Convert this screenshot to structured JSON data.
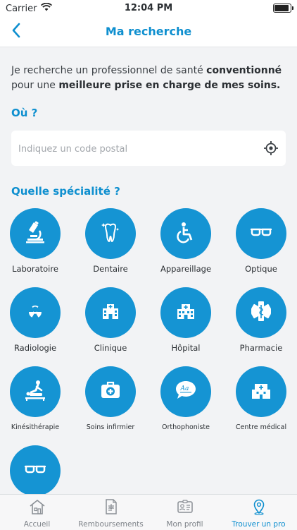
{
  "status_bar": {
    "carrier": "Carrier",
    "time": "12:04 PM"
  },
  "nav": {
    "title": "Ma recherche"
  },
  "intro": {
    "part1": "Je recherche un professionnel de santé ",
    "bold1": "conventionné",
    "part2": " pour une ",
    "bold2": "meilleure prise en charge de mes soins."
  },
  "location": {
    "title": "Où ?",
    "placeholder": "Indiquez un code postal",
    "value": ""
  },
  "specialty": {
    "title": "Quelle spécialité ?",
    "items": [
      {
        "label": "Laboratoire",
        "icon": "microscope-icon"
      },
      {
        "label": "Dentaire",
        "icon": "tooth-icon"
      },
      {
        "label": "Appareillage",
        "icon": "wheelchair-icon"
      },
      {
        "label": "Optique",
        "icon": "glasses-icon"
      },
      {
        "label": "Radiologie",
        "icon": "radiation-icon"
      },
      {
        "label": "Clinique",
        "icon": "hospital-building-icon"
      },
      {
        "label": "Hôpital",
        "icon": "hospital-icon"
      },
      {
        "label": "Pharmacie",
        "icon": "caduceus-icon"
      },
      {
        "label": "Kinésithérapie",
        "icon": "massage-icon"
      },
      {
        "label": "Soins infirmier",
        "icon": "first-aid-kit-icon"
      },
      {
        "label": "Orthophoniste",
        "icon": "speech-bubble-icon"
      },
      {
        "label": "Centre médical",
        "icon": "medical-center-icon"
      },
      {
        "label": "",
        "icon": "glasses-icon"
      }
    ]
  },
  "tabs": [
    {
      "label": "Accueil",
      "icon": "home-icon",
      "active": false
    },
    {
      "label": "Remboursements",
      "icon": "document-icon",
      "active": false
    },
    {
      "label": "Mon profil",
      "icon": "id-card-icon",
      "active": false
    },
    {
      "label": "Trouver un pro",
      "icon": "location-pin-icon",
      "active": true
    }
  ],
  "colors": {
    "accent": "#0e8fcf",
    "tile": "#1594d3",
    "background": "#f2f3f5"
  }
}
